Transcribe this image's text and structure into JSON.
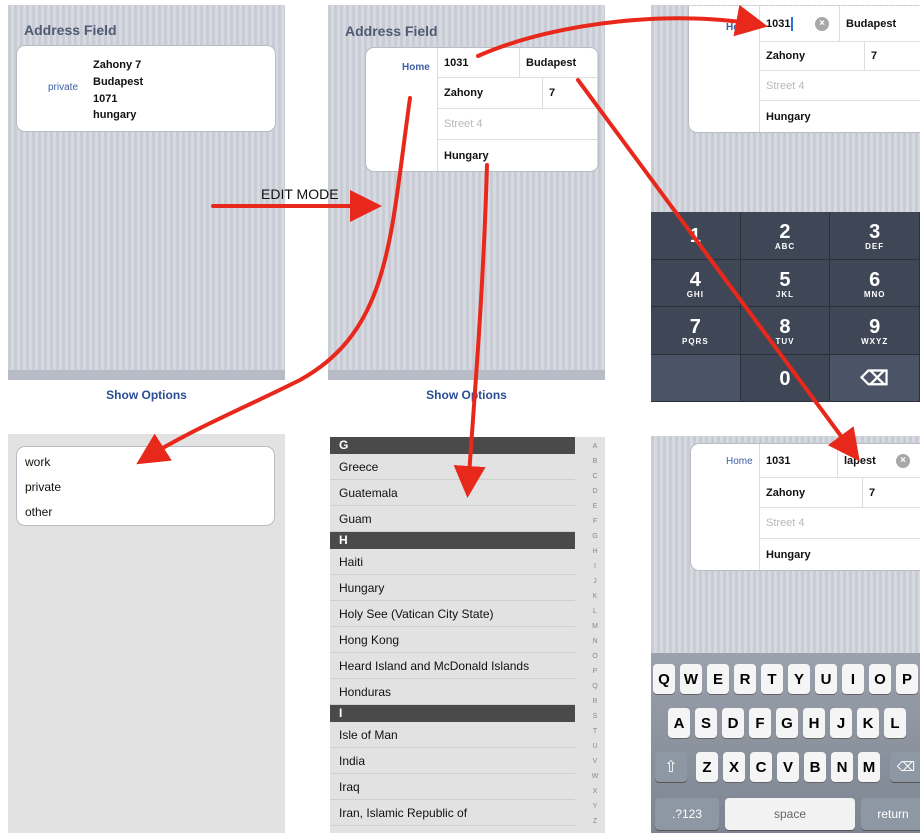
{
  "panel1": {
    "title": "Address Field",
    "label": "private",
    "lines": [
      "Zahony 7",
      "Budapest",
      "1071",
      "hungary"
    ],
    "show_options": "Show Options"
  },
  "annotation": "EDIT MODE",
  "panel2": {
    "title": "Address Field",
    "label": "Home",
    "zip": "1031",
    "city": "Budapest",
    "street": "Zahony",
    "number": "7",
    "street2_placeholder": "Street 4",
    "country": "Hungary",
    "show_options": "Show Options"
  },
  "panel3": {
    "label": "Home",
    "zip": "1031",
    "city": "Budapest",
    "street": "Zahony",
    "number": "7",
    "street2_placeholder": "Street 4",
    "country": "Hungary",
    "keypad": [
      {
        "n": "1",
        "s": ""
      },
      {
        "n": "2",
        "s": "ABC"
      },
      {
        "n": "3",
        "s": "DEF"
      },
      {
        "n": "4",
        "s": "GHI"
      },
      {
        "n": "5",
        "s": "JKL"
      },
      {
        "n": "6",
        "s": "MNO"
      },
      {
        "n": "7",
        "s": "PQRS"
      },
      {
        "n": "8",
        "s": "TUV"
      },
      {
        "n": "9",
        "s": "WXYZ"
      },
      {
        "n": "",
        "s": ""
      },
      {
        "n": "0",
        "s": ""
      },
      {
        "n": "⌫",
        "s": ""
      }
    ]
  },
  "panel4": {
    "options": [
      "work",
      "private",
      "other"
    ]
  },
  "panel5": {
    "sections": [
      {
        "letter": "G",
        "items": [
          "Greece",
          "Guatemala",
          "Guam"
        ]
      },
      {
        "letter": "H",
        "items": [
          "Haiti",
          "Hungary",
          "Holy See (Vatican City State)",
          "Hong Kong",
          "Heard Island and McDonald Islands",
          "Honduras"
        ]
      },
      {
        "letter": "I",
        "items": [
          "Isle of Man",
          "India",
          "Iraq",
          "Iran, Islamic Republic of"
        ]
      }
    ],
    "index": [
      "A",
      "B",
      "C",
      "D",
      "E",
      "F",
      "G",
      "H",
      "I",
      "J",
      "K",
      "L",
      "M",
      "N",
      "O",
      "P",
      "Q",
      "R",
      "S",
      "T",
      "U",
      "V",
      "W",
      "X",
      "Y",
      "Z"
    ]
  },
  "panel6": {
    "label": "Home",
    "zip": "1031",
    "city": "lapest",
    "street": "Zahony",
    "number": "7",
    "street2_placeholder": "Street 4",
    "country": "Hungary",
    "keyboard": {
      "row1": [
        "Q",
        "W",
        "E",
        "R",
        "T",
        "Y",
        "U",
        "I",
        "O",
        "P"
      ],
      "row2": [
        "A",
        "S",
        "D",
        "F",
        "G",
        "H",
        "J",
        "K",
        "L"
      ],
      "row3": [
        "Z",
        "X",
        "C",
        "V",
        "B",
        "N",
        "M"
      ],
      "num_key": ".?123",
      "space_key": "space",
      "return_key": "return"
    }
  },
  "colors": {
    "arrow": "#e8281b",
    "link": "#2a4d94",
    "label": "#3d5ea3"
  }
}
